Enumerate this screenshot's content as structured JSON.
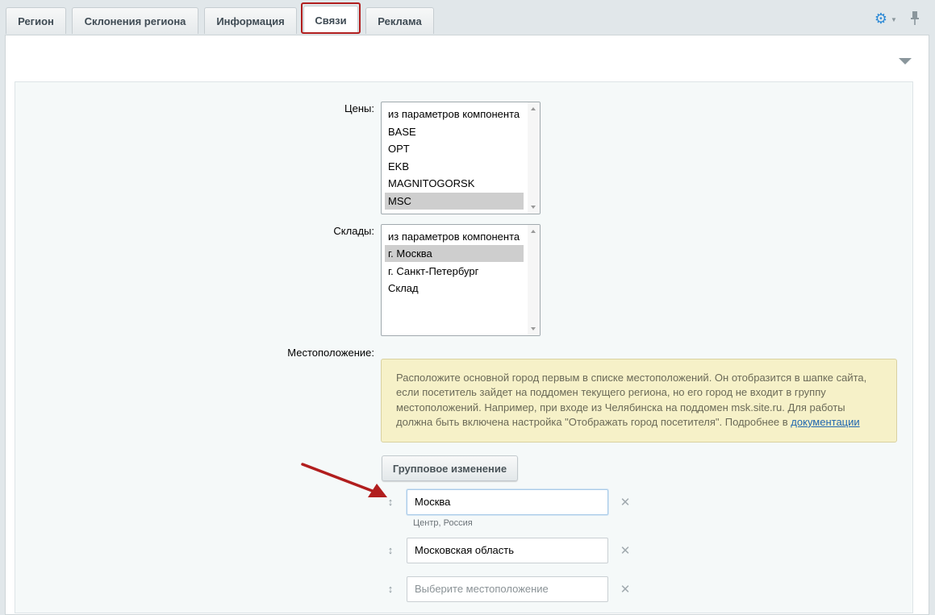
{
  "tabs": [
    {
      "label": "Регион"
    },
    {
      "label": "Склонения региона"
    },
    {
      "label": "Информация"
    },
    {
      "label": "Связи",
      "active": true
    },
    {
      "label": "Реклама"
    }
  ],
  "toolbar": {
    "settings_icon": "gear-icon",
    "pin_icon": "pin-icon"
  },
  "form": {
    "prices": {
      "label": "Цены:",
      "options": [
        "из параметров компонента",
        "BASE",
        "OPT",
        "EKB",
        "MAGNITOGORSK",
        "MSC"
      ],
      "selected": "MSC"
    },
    "warehouses": {
      "label": "Склады:",
      "options": [
        "из параметров компонента",
        "г. Москва",
        "г. Санкт-Петербург",
        "Склад"
      ],
      "selected": "г. Москва"
    },
    "location": {
      "label": "Местоположение:",
      "note_text": "Расположите основной город первым в списке местоположений. Он отобразится в шапке сайта, если посетитель зайдет на поддомен текущего региона, но его город не входит в группу местоположений. Например, при входе из Челябинска на поддомен msk.site.ru. Для работы должна быть включена настройка \"Отображать город посетителя\". Подробнее в ",
      "note_link": "документации",
      "group_button": "Групповое изменение",
      "items": [
        {
          "value": "Москва",
          "hint": "Центр, Россия"
        },
        {
          "value": "Московская область"
        },
        {
          "value": "",
          "placeholder": "Выберите местоположение"
        }
      ]
    }
  },
  "colors": {
    "accent_highlight": "#b11e1e",
    "note_bg": "#f6f1c8",
    "link": "#2067b0"
  }
}
